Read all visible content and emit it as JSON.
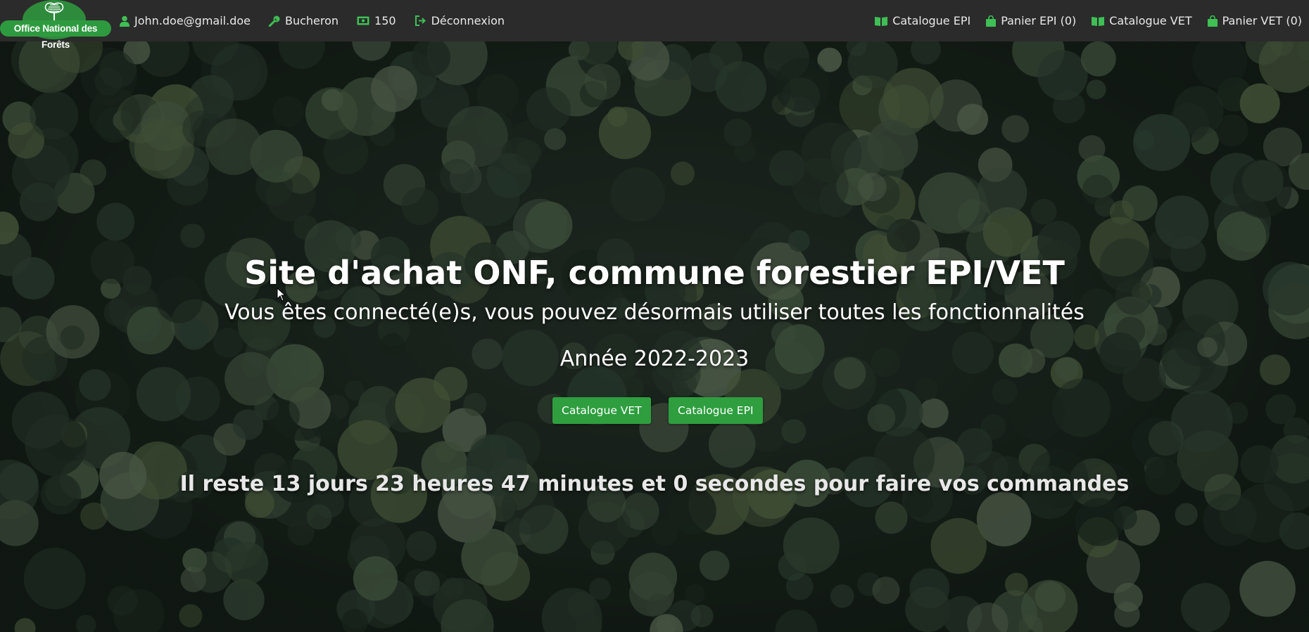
{
  "navbar": {
    "brand": {
      "text": "Office National des Forêts",
      "icon": "tree-logo-icon"
    },
    "left": [
      {
        "icon": "user-icon",
        "label": "John.doe@gmail.doe"
      },
      {
        "icon": "wrench-icon",
        "label": "Bucheron"
      },
      {
        "icon": "money-icon",
        "label": "150"
      },
      {
        "icon": "sign-out-icon",
        "label": "Déconnexion"
      }
    ],
    "right": [
      {
        "icon": "book-icon",
        "label": "Catalogue EPI"
      },
      {
        "icon": "shopping-bag-icon",
        "label": "Panier EPI (0)"
      },
      {
        "icon": "book-icon",
        "label": "Catalogue VET"
      },
      {
        "icon": "shopping-bag-icon",
        "label": "Panier VET (0)"
      }
    ]
  },
  "hero": {
    "title": "Site d'achat ONF, commune forestier EPI/VET",
    "subtitle": "Vous êtes connecté(e)s, vous pouvez désormais utiliser toutes les fonctionnalités",
    "year": "Année 2022-2023",
    "buttons": {
      "vet": "Catalogue VET",
      "epi": "Catalogue EPI"
    },
    "countdown": "Il reste 13 jours 23 heures 47 minutes et 0 secondes pour faire vos commandes"
  },
  "colors": {
    "navbar_bg": "#2b2b2b",
    "accent_green": "#2e9e3f",
    "icon_green": "#3fbf55"
  }
}
